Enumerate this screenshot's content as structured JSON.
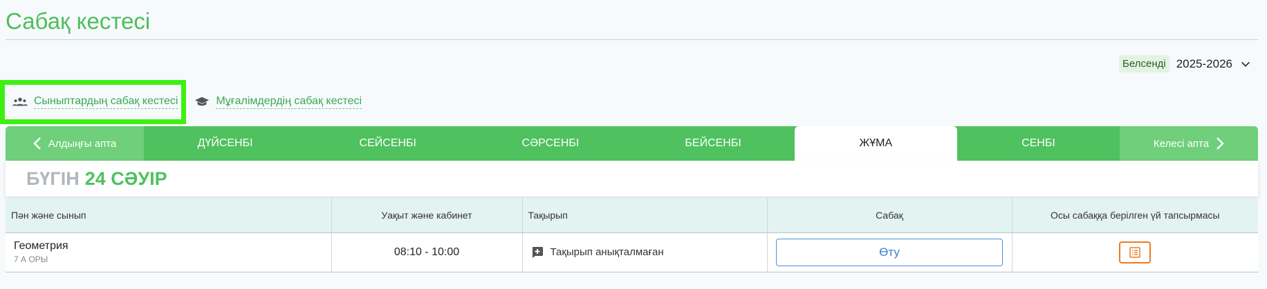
{
  "page": {
    "title": "Сабақ кестесі"
  },
  "year": {
    "badge": "Белсенді",
    "value": "2025-2026"
  },
  "view_tabs": [
    {
      "label": "Сыныптардың сабақ кестесі",
      "icon": "users-icon",
      "selected": true
    },
    {
      "label": "Мұғалімдердің сабақ кестесі",
      "icon": "graduation-cap-icon",
      "selected": false
    }
  ],
  "week": {
    "prev_label": "Алдыңғы апта",
    "next_label": "Келесі апта",
    "days": [
      "ДҮЙСЕНБІ",
      "СЕЙСЕНБІ",
      "СӘРСЕНБІ",
      "БЕЙСЕНБІ",
      "ЖҰМА",
      "СЕНБІ"
    ],
    "active_day": "ЖҰМА"
  },
  "today": {
    "word": "БҮГІН",
    "date": "24 СӘУІР"
  },
  "table": {
    "headers": [
      "Пән және сынып",
      "Уақыт және кабинет",
      "Тақырып",
      "Сабақ",
      "Осы сабаққа берілген үй тапсырмасы"
    ],
    "rows": [
      {
        "subject": "Геометрия",
        "class": "7 А ОРЫ",
        "time": "08:10 - 10:00",
        "topic": "Тақырып анықталмаған",
        "lesson_button": "Өту",
        "homework_icon": "list-icon"
      }
    ]
  },
  "colors": {
    "accent": "#4fc15f",
    "highlight": "#3ef012",
    "homework": "#f07a1c",
    "link": "#4a90d9"
  }
}
